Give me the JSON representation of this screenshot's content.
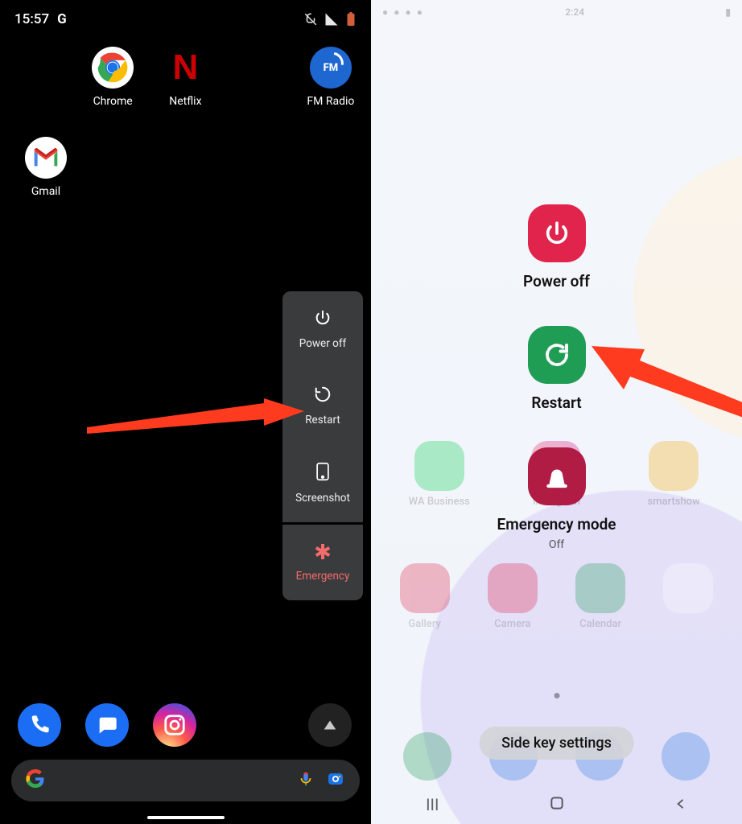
{
  "left": {
    "status": {
      "time": "15:57",
      "g_logo": "G"
    },
    "apps_row1": [
      {
        "label": "Chrome"
      },
      {
        "label": "Netflix"
      },
      {
        "label": ""
      },
      {
        "label": "FM Radio"
      }
    ],
    "apps_row2": [
      {
        "label": "Gmail"
      }
    ],
    "power_menu": {
      "power_off": "Power off",
      "restart": "Restart",
      "screenshot": "Screenshot",
      "emergency": "Emergency"
    }
  },
  "right": {
    "status_time": "2:24",
    "options": {
      "power_off": "Power off",
      "restart": "Restart",
      "emergency": "Emergency mode",
      "emergency_sub": "Off"
    },
    "bg_row1": [
      "WA Business",
      "Instagram",
      "smartshow"
    ],
    "bg_row2": [
      "Gallery",
      "Camera",
      "Calendar",
      ""
    ],
    "side_key": "Side key settings"
  }
}
